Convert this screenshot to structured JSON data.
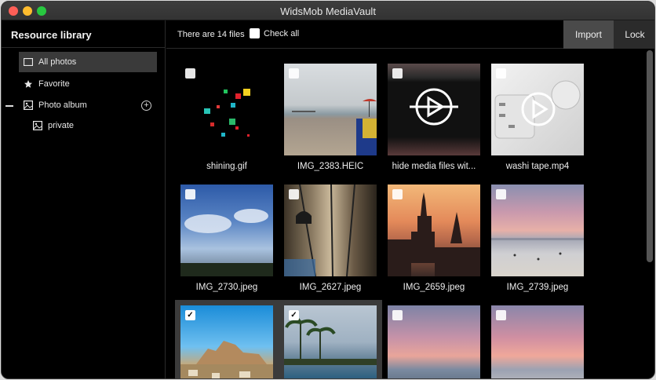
{
  "window": {
    "title": "WidsMob MediaVault"
  },
  "sidebar": {
    "header": "Resource library",
    "items": [
      {
        "label": "All photos",
        "icon": "square-icon",
        "selected": true
      },
      {
        "label": "Favorite",
        "icon": "star-icon",
        "selected": false
      },
      {
        "label": "Photo album",
        "icon": "image-icon",
        "selected": false
      },
      {
        "label": "private",
        "icon": "image-icon",
        "selected": false
      }
    ]
  },
  "toolbar": {
    "count_text": "There are 14 files",
    "check_all_label": "Check all",
    "import_label": "Import",
    "lock_label": "Lock"
  },
  "files": [
    {
      "name": "shining.gif",
      "checked": false
    },
    {
      "name": "IMG_2383.HEIC",
      "checked": false
    },
    {
      "name": "hide media files wit...",
      "checked": false
    },
    {
      "name": "washi tape.mp4",
      "checked": false
    },
    {
      "name": "IMG_2730.jpeg",
      "checked": false
    },
    {
      "name": "IMG_2627.jpeg",
      "checked": false
    },
    {
      "name": "IMG_2659.jpeg",
      "checked": false
    },
    {
      "name": "IMG_2739.jpeg",
      "checked": false
    },
    {
      "name": "",
      "checked": true
    },
    {
      "name": "",
      "checked": true
    },
    {
      "name": "",
      "checked": false
    },
    {
      "name": "",
      "checked": false
    }
  ],
  "colors": {
    "background": "#000000",
    "sidebar_selected": "#3a3a3a",
    "import_button": "#4a4a4a",
    "lock_button": "#2b2b2b"
  }
}
